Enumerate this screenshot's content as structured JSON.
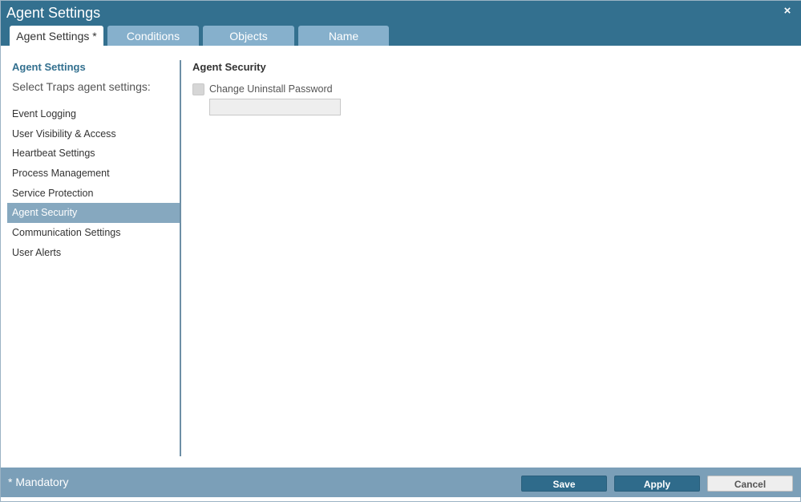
{
  "window": {
    "title": "Agent Settings",
    "close_glyph": "×"
  },
  "tabs": [
    {
      "label": "Agent Settings *"
    },
    {
      "label": "Conditions"
    },
    {
      "label": "Objects"
    },
    {
      "label": "Name"
    }
  ],
  "sidebar": {
    "heading": "Agent Settings",
    "subheading": "Select Traps agent settings:",
    "items": [
      {
        "label": "Event Logging"
      },
      {
        "label": "User Visibility & Access"
      },
      {
        "label": "Heartbeat Settings"
      },
      {
        "label": "Process Management"
      },
      {
        "label": "Service Protection"
      },
      {
        "label": "Agent Security"
      },
      {
        "label": "Communication Settings"
      },
      {
        "label": "User Alerts"
      }
    ]
  },
  "main": {
    "section_title": "Agent Security",
    "checkbox_label": "Change Uninstall Password",
    "password_value": ""
  },
  "footer": {
    "mandatory": "* Mandatory",
    "save_label": "Save",
    "apply_label": "Apply",
    "cancel_label": "Cancel"
  },
  "colors": {
    "titlebar": "#33708f",
    "accent": "#2f6b8b",
    "footer": "#7b9fb8",
    "selected_item": "#86a8bf"
  }
}
